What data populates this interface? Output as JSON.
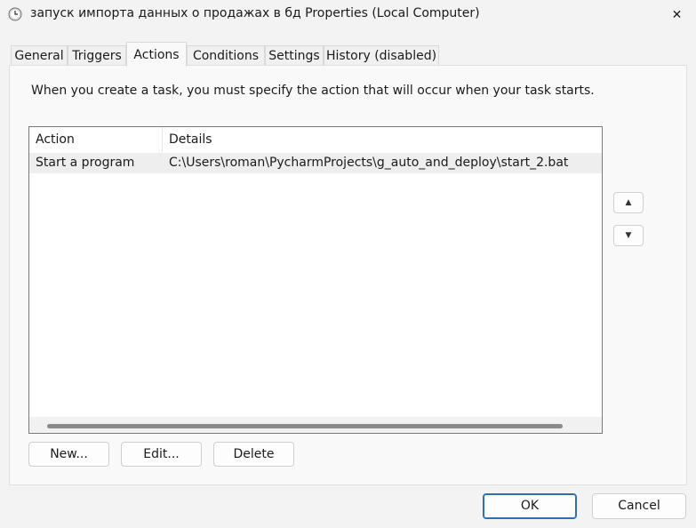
{
  "window": {
    "title": "запуск импорта данных о продажах в бд Properties (Local Computer)",
    "icon": "clock-icon",
    "close_glyph": "✕"
  },
  "tabs": [
    {
      "label": "General",
      "active": false
    },
    {
      "label": "Triggers",
      "active": false
    },
    {
      "label": "Actions",
      "active": true
    },
    {
      "label": "Conditions",
      "active": false
    },
    {
      "label": "Settings",
      "active": false
    },
    {
      "label": "History (disabled)",
      "active": false
    }
  ],
  "actions_page": {
    "intro": "When you create a task, you must specify the action that will occur when your task starts.",
    "columns": [
      "Action",
      "Details"
    ],
    "rows": [
      {
        "action": "Start a program",
        "details": "C:\\Users\\roman\\PycharmProjects\\g_auto_and_deploy\\start_2.bat"
      }
    ],
    "move_up_glyph": "▲",
    "move_down_glyph": "▼",
    "buttons": {
      "new": "New...",
      "edit": "Edit...",
      "delete": "Delete"
    }
  },
  "footer": {
    "ok": "OK",
    "cancel": "Cancel"
  }
}
